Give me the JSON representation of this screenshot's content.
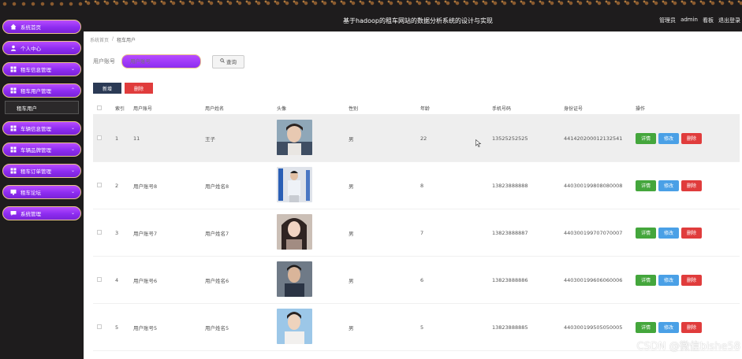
{
  "header": {
    "title": "基于hadoop的租车网站的数据分析系统的设计与实现",
    "user_role": "管理员",
    "username": "admin",
    "homepage": "看板",
    "logout": "退出登录"
  },
  "sidebar": {
    "items": [
      {
        "label": "系统首页",
        "icon": "home-icon",
        "chevron": ""
      },
      {
        "label": "个人中心",
        "icon": "user-icon",
        "chevron": "⌄"
      },
      {
        "label": "租车信息管理",
        "icon": "grid-icon",
        "chevron": "⌄"
      },
      {
        "label": "租车用户管理",
        "icon": "grid-icon",
        "chevron": "⌃"
      },
      {
        "label": "车辆信息管理",
        "icon": "grid-icon",
        "chevron": "⌄"
      },
      {
        "label": "车辆品牌管理",
        "icon": "grid-icon",
        "chevron": "⌄"
      },
      {
        "label": "租车订单管理",
        "icon": "grid-icon",
        "chevron": "⌄"
      },
      {
        "label": "租车论坛",
        "icon": "monitor-icon",
        "chevron": "⌄"
      },
      {
        "label": "系统管理",
        "icon": "chat-icon",
        "chevron": "⌄"
      }
    ],
    "subitem": "租车用户"
  },
  "breadcrumb": {
    "home": "系统首页",
    "sep": "/",
    "current": "租车用户"
  },
  "search": {
    "label": "用户账号",
    "placeholder": "用户账号",
    "button": "查询"
  },
  "actions": {
    "add": "新增",
    "delete": "删除"
  },
  "table": {
    "headers": {
      "index": "索引",
      "account": "用户账号",
      "name": "用户姓名",
      "avatar": "头像",
      "gender": "性别",
      "age": "年龄",
      "phone": "手机号码",
      "idcard": "身份证号",
      "ops": "操作"
    },
    "op_labels": {
      "detail": "详情",
      "edit": "修改",
      "delete": "删除"
    },
    "rows": [
      {
        "index": "1",
        "account": "11",
        "name": "王子",
        "gender": "男",
        "age": "22",
        "phone": "13525252525",
        "idcard": "441420200012132541"
      },
      {
        "index": "2",
        "account": "用户账号8",
        "name": "用户姓名8",
        "gender": "男",
        "age": "8",
        "phone": "13823888888",
        "idcard": "440300199808080008"
      },
      {
        "index": "3",
        "account": "用户账号7",
        "name": "用户姓名7",
        "gender": "男",
        "age": "7",
        "phone": "13823888887",
        "idcard": "440300199707070007"
      },
      {
        "index": "4",
        "account": "用户账号6",
        "name": "用户姓名6",
        "gender": "男",
        "age": "6",
        "phone": "13823888886",
        "idcard": "440300199606060006"
      },
      {
        "index": "5",
        "account": "用户账号5",
        "name": "用户姓名5",
        "gender": "男",
        "age": "5",
        "phone": "13823888885",
        "idcard": "440300199505050005"
      }
    ]
  },
  "watermark": "CSDN @微信bishe58",
  "colors": {
    "menu_purple": "#8d2cf0",
    "menu_border": "#e9c38a",
    "dark_bg": "#1e1c1d",
    "detail_green": "#44a63c",
    "edit_blue": "#4aa0e6",
    "delete_red": "#e03c3c",
    "add_navy": "#2b3a55"
  }
}
